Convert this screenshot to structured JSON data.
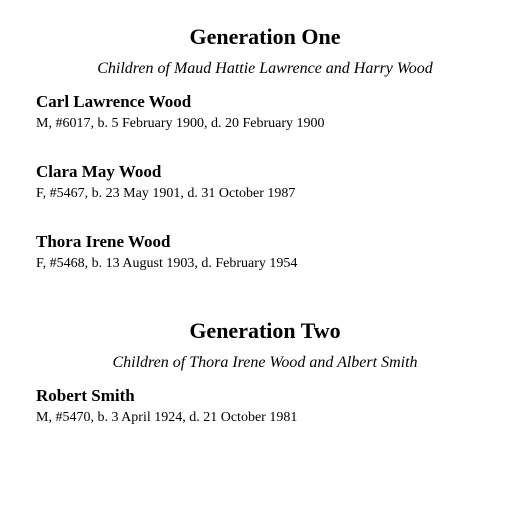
{
  "generations": [
    {
      "title": "Generation One",
      "subtitle": "Children of Maud Hattie Lawrence and Harry Wood",
      "people": [
        {
          "name": "Carl Lawrence Wood",
          "detail": "M, #6017, b. 5 February 1900, d. 20 February 1900"
        },
        {
          "name": "Clara May Wood",
          "detail": "F, #5467, b. 23 May 1901, d. 31 October 1987"
        },
        {
          "name": "Thora Irene Wood",
          "detail": "F, #5468, b. 13 August 1903, d. February 1954"
        }
      ]
    },
    {
      "title": "Generation Two",
      "subtitle": "Children of Thora Irene Wood and Albert Smith",
      "people": [
        {
          "name": "Robert Smith",
          "detail": "M, #5470, b. 3 April 1924, d. 21 October 1981"
        }
      ]
    }
  ]
}
